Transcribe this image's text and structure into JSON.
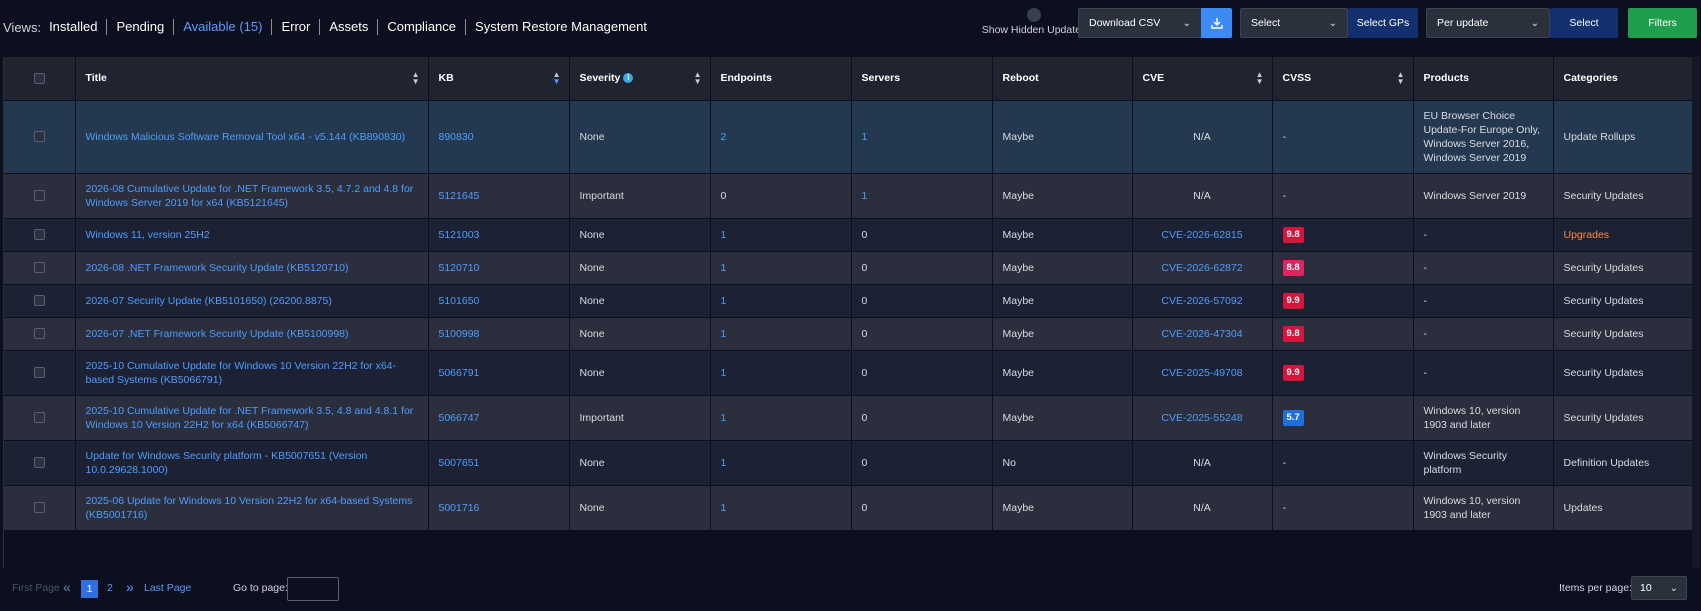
{
  "views": {
    "label": "Views:",
    "items": [
      "Installed",
      "Pending",
      "Available (15)",
      "Error",
      "Assets",
      "Compliance",
      "System Restore Management"
    ],
    "active_index": 2
  },
  "toolbar": {
    "show_hidden": "Show Hidden Updates",
    "download": "Download CSV",
    "select_gp": "Select",
    "select_gps_btn": "Select GPs",
    "per_update": "Per update",
    "select_btn": "Select",
    "filters": "Filters"
  },
  "columns": [
    "Title",
    "KB",
    "Severity",
    "Endpoints",
    "Servers",
    "Reboot",
    "CVE",
    "CVSS",
    "Products",
    "Categories"
  ],
  "rows": [
    {
      "title": "Windows Malicious Software Removal Tool x64 - v5.144 (KB890830)",
      "kb": "890830",
      "severity": "None",
      "endpoints": "2",
      "endpoints_link": true,
      "servers": "1",
      "servers_link": true,
      "reboot": "Maybe",
      "cve": "N/A",
      "cve_link": false,
      "cvss": "-",
      "cvss_color": "",
      "products": "EU Browser Choice Update-For Europe Only, Windows Server 2016, Windows Server 2019",
      "categories": "Update Rollups",
      "cat_orange": false,
      "selected": true
    },
    {
      "title": "2026-08 Cumulative Update for .NET Framework 3.5, 4.7.2 and 4.8 for Windows Server 2019 for x64 (KB5121645)",
      "kb": "5121645",
      "severity": "Important",
      "endpoints": "0",
      "endpoints_link": false,
      "servers": "1",
      "servers_link": true,
      "reboot": "Maybe",
      "cve": "N/A",
      "cve_link": false,
      "cvss": "-",
      "cvss_color": "",
      "products": "Windows Server 2019",
      "categories": "Security Updates",
      "cat_orange": false,
      "selected": false
    },
    {
      "title": "Windows 11, version 25H2",
      "kb": "5121003",
      "severity": "None",
      "endpoints": "1",
      "endpoints_link": true,
      "servers": "0",
      "servers_link": false,
      "reboot": "Maybe",
      "cve": "CVE-2026-62815",
      "cve_link": true,
      "cvss": "9.8",
      "cvss_color": "#d4163c",
      "products": "-",
      "categories": "Upgrades",
      "cat_orange": true,
      "selected": false
    },
    {
      "title": "2026-08 .NET Framework Security Update (KB5120710)",
      "kb": "5120710",
      "severity": "None",
      "endpoints": "1",
      "endpoints_link": true,
      "servers": "0",
      "servers_link": false,
      "reboot": "Maybe",
      "cve": "CVE-2026-62872",
      "cve_link": true,
      "cvss": "8.8",
      "cvss_color": "#e0245e",
      "products": "-",
      "categories": "Security Updates",
      "cat_orange": false,
      "selected": false
    },
    {
      "title": "2026-07 Security Update (KB5101650) (26200.8875)",
      "kb": "5101650",
      "severity": "None",
      "endpoints": "1",
      "endpoints_link": true,
      "servers": "0",
      "servers_link": false,
      "reboot": "Maybe",
      "cve": "CVE-2026-57092",
      "cve_link": true,
      "cvss": "9.9",
      "cvss_color": "#d4163c",
      "products": "-",
      "categories": "Security Updates",
      "cat_orange": false,
      "selected": false
    },
    {
      "title": "2026-07 .NET Framework Security Update (KB5100998)",
      "kb": "5100998",
      "severity": "None",
      "endpoints": "1",
      "endpoints_link": true,
      "servers": "0",
      "servers_link": false,
      "reboot": "Maybe",
      "cve": "CVE-2026-47304",
      "cve_link": true,
      "cvss": "9.8",
      "cvss_color": "#d4163c",
      "products": "-",
      "categories": "Security Updates",
      "cat_orange": false,
      "selected": false
    },
    {
      "title": "2025-10 Cumulative Update for Windows 10 Version 22H2 for x64-based Systems (KB5066791)",
      "kb": "5066791",
      "severity": "None",
      "endpoints": "1",
      "endpoints_link": true,
      "servers": "0",
      "servers_link": false,
      "reboot": "Maybe",
      "cve": "CVE-2025-49708",
      "cve_link": true,
      "cvss": "9.9",
      "cvss_color": "#d4163c",
      "products": "-",
      "categories": "Security Updates",
      "cat_orange": false,
      "selected": false
    },
    {
      "title": "2025-10 Cumulative Update for .NET Framework 3.5, 4.8 and 4.8.1 for Windows 10 Version 22H2 for x64 (KB5066747)",
      "kb": "5066747",
      "severity": "Important",
      "endpoints": "1",
      "endpoints_link": true,
      "servers": "0",
      "servers_link": false,
      "reboot": "Maybe",
      "cve": "CVE-2025-55248",
      "cve_link": true,
      "cvss": "5.7",
      "cvss_color": "#1f6fe0",
      "products": "Windows 10, version 1903 and later",
      "categories": "Security Updates",
      "cat_orange": false,
      "selected": false
    },
    {
      "title": "Update for Windows Security platform - KB5007651 (Version 10.0.29628.1000)",
      "kb": "5007651",
      "severity": "None",
      "endpoints": "1",
      "endpoints_link": true,
      "servers": "0",
      "servers_link": false,
      "reboot": "No",
      "cve": "N/A",
      "cve_link": false,
      "cvss": "-",
      "cvss_color": "",
      "products": "Windows Security platform",
      "categories": "Definition Updates",
      "cat_orange": false,
      "selected": false
    },
    {
      "title": "2025-06 Update for Windows 10 Version 22H2 for x64-based Systems (KB5001716)",
      "kb": "5001716",
      "severity": "None",
      "endpoints": "1",
      "endpoints_link": true,
      "servers": "0",
      "servers_link": false,
      "reboot": "Maybe",
      "cve": "N/A",
      "cve_link": false,
      "cvss": "-",
      "cvss_color": "",
      "products": "Windows 10, version 1903 and later",
      "categories": "Updates",
      "cat_orange": false,
      "selected": false
    }
  ],
  "pagination": {
    "first": "First Page",
    "current": "1",
    "page2": "2",
    "last": "Last Page",
    "goto_label": "Go to page:",
    "goto_value": "",
    "items_label": "Items per page:",
    "items_value": "10"
  }
}
